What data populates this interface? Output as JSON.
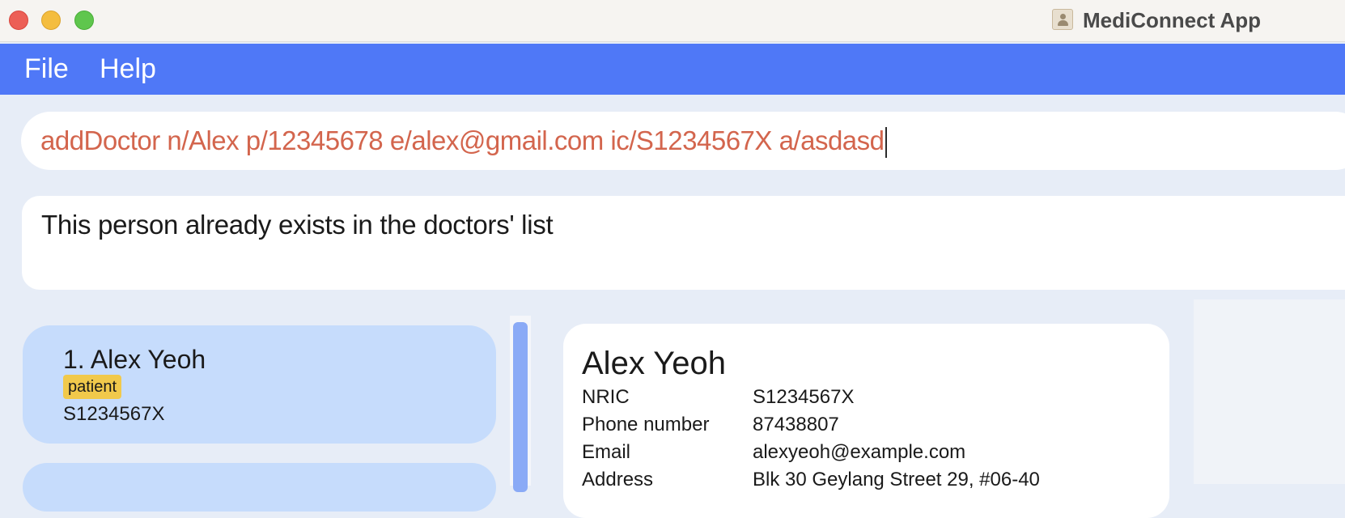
{
  "window": {
    "title": "MediConnect App",
    "app_icon": "contact-book-icon",
    "controls": [
      "close",
      "minimize",
      "zoom"
    ]
  },
  "menu": {
    "items": [
      {
        "label": "File"
      },
      {
        "label": "Help"
      }
    ]
  },
  "command": {
    "value": "addDoctor n/Alex p/12345678 e/alex@gmail.com ic/S1234567X a/asdasd"
  },
  "result": {
    "message": "This person already exists in the doctors' list"
  },
  "person_list": {
    "items": [
      {
        "index": "1.",
        "name": "Alex Yeoh",
        "name_line": "1.  Alex Yeoh",
        "tag": "patient",
        "nric": "S1234567X"
      }
    ]
  },
  "detail": {
    "name": "Alex Yeoh",
    "fields": [
      {
        "label": "NRIC",
        "value": "S1234567X"
      },
      {
        "label": "Phone number",
        "value": "87438807"
      },
      {
        "label": "Email",
        "value": "alexyeoh@example.com"
      },
      {
        "label": "Address",
        "value": "Blk 30 Geylang Street 29, #06-40"
      }
    ]
  },
  "colors": {
    "menu_bar": "#4f78f7",
    "command_text": "#d3654d",
    "list_card": "#c6dcfc",
    "tag": "#f1c94b",
    "scroll_thumb": "#8aaaf6",
    "background": "#e7edf7"
  }
}
